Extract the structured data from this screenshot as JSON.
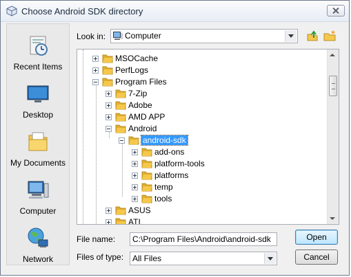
{
  "window": {
    "title": "Choose Android SDK directory"
  },
  "icons": {
    "app": "java-cube-icon",
    "close": "close-icon"
  },
  "places": [
    {
      "label": "Recent Items",
      "icon": "recent-items-icon"
    },
    {
      "label": "Desktop",
      "icon": "desktop-icon"
    },
    {
      "label": "My Documents",
      "icon": "my-documents-icon"
    },
    {
      "label": "Computer",
      "icon": "computer-icon"
    },
    {
      "label": "Network",
      "icon": "network-icon"
    }
  ],
  "lookin": {
    "label": "Look in:",
    "value": "Computer"
  },
  "tree": {
    "items": [
      {
        "name": "MSOCache",
        "depth": 1,
        "expander": "plus"
      },
      {
        "name": "PerfLogs",
        "depth": 1,
        "expander": "plus"
      },
      {
        "name": "Program Files",
        "depth": 1,
        "expander": "minus"
      },
      {
        "name": "7-Zip",
        "depth": 2,
        "expander": "plus"
      },
      {
        "name": "Adobe",
        "depth": 2,
        "expander": "plus"
      },
      {
        "name": "AMD APP",
        "depth": 2,
        "expander": "plus"
      },
      {
        "name": "Android",
        "depth": 2,
        "expander": "minus"
      },
      {
        "name": "android-sdk",
        "depth": 3,
        "expander": "minus",
        "selected": true
      },
      {
        "name": "add-ons",
        "depth": 4,
        "expander": "plus"
      },
      {
        "name": "platform-tools",
        "depth": 4,
        "expander": "plus"
      },
      {
        "name": "platforms",
        "depth": 4,
        "expander": "plus"
      },
      {
        "name": "temp",
        "depth": 4,
        "expander": "plus"
      },
      {
        "name": "tools",
        "depth": 4,
        "expander": "plus"
      },
      {
        "name": "ASUS",
        "depth": 2,
        "expander": "plus"
      },
      {
        "name": "ATI",
        "depth": 2,
        "expander": "plus"
      }
    ]
  },
  "file_name": {
    "label": "File name:",
    "value": "C:\\Program Files\\Android\\android-sdk"
  },
  "file_type": {
    "label": "Files of type:",
    "value": "All Files"
  },
  "buttons": {
    "open": "Open",
    "cancel": "Cancel"
  },
  "colors": {
    "selection": "#3399ff",
    "folder": "#f5c84c"
  }
}
